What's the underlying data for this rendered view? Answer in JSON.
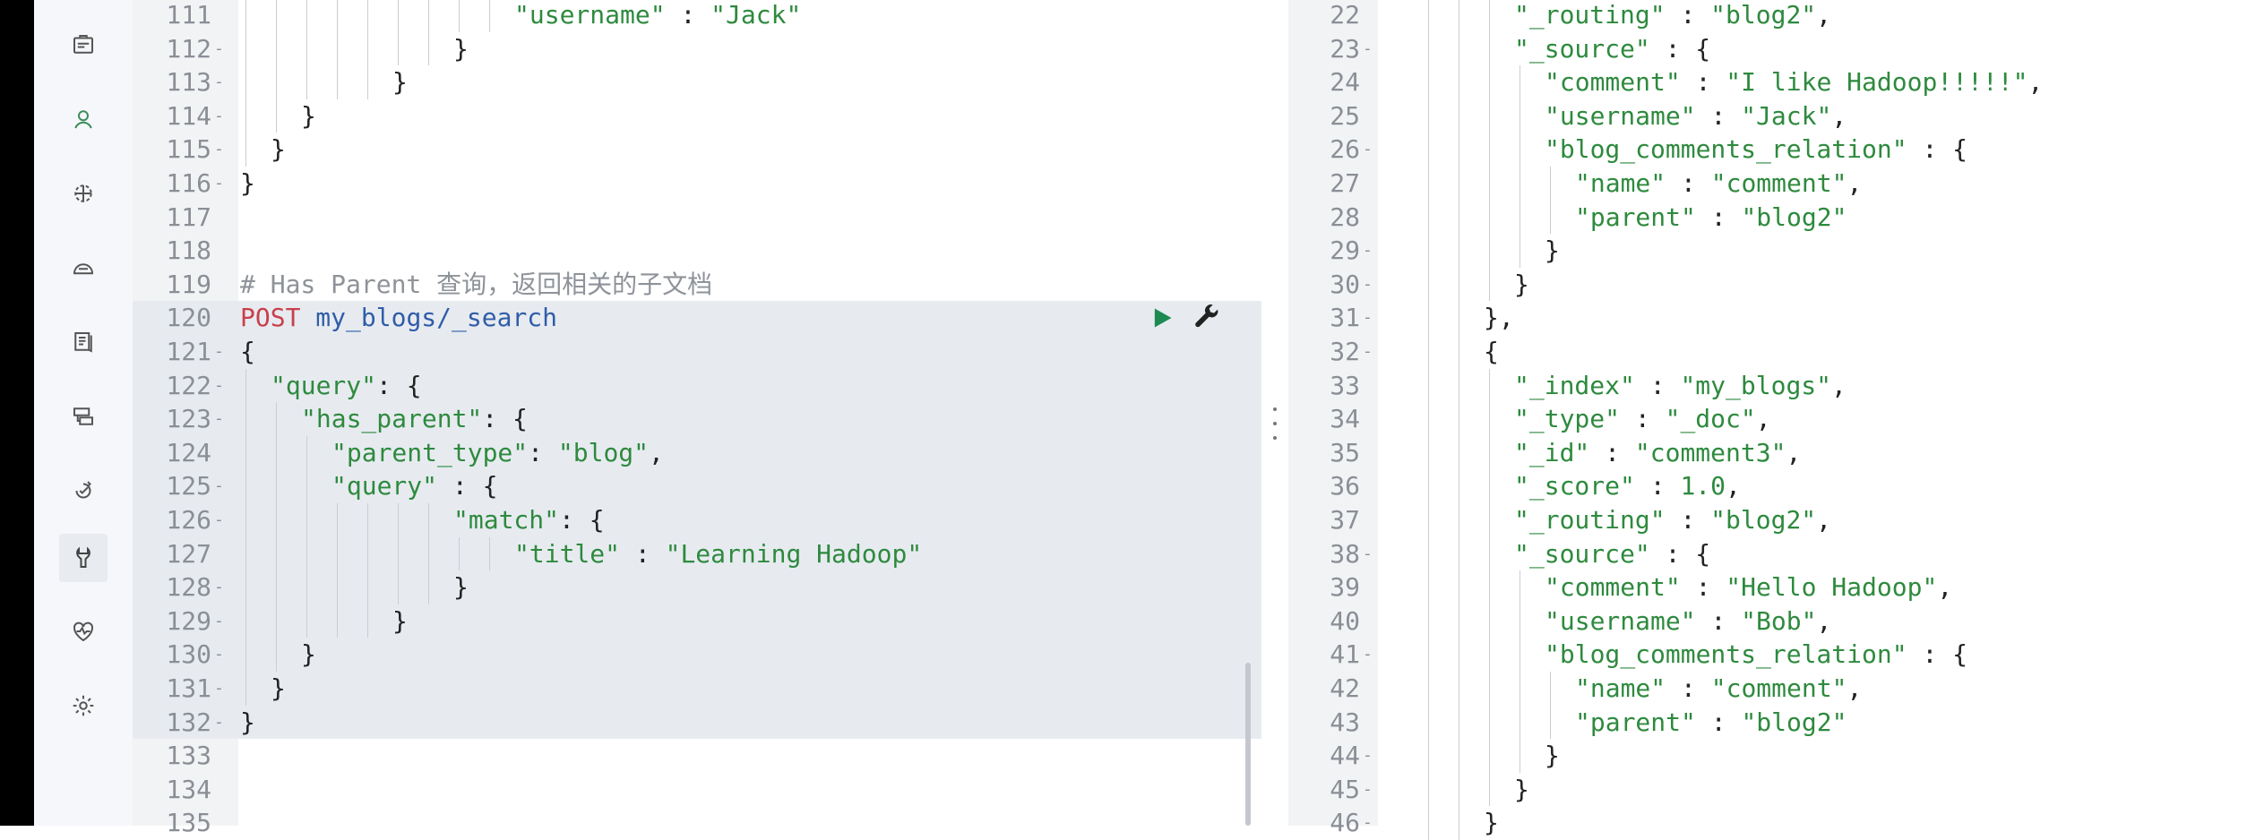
{
  "sidebar": {
    "items": [
      {
        "icon": "discover-icon"
      },
      {
        "icon": "maps-icon"
      },
      {
        "icon": "canvas-icon"
      },
      {
        "icon": "ml-icon"
      },
      {
        "icon": "infrastructure-icon"
      },
      {
        "icon": "logs-icon"
      },
      {
        "icon": "uptime-icon"
      },
      {
        "icon": "dev-tools-icon"
      },
      {
        "icon": "monitoring-icon"
      },
      {
        "icon": "management-icon"
      }
    ]
  },
  "editor": {
    "lines": [
      {
        "n": "111",
        "fold": "",
        "text": "\"username\" : \"Jack\"",
        "indent": 9
      },
      {
        "n": "112",
        "fold": "-",
        "text": "}",
        "indent": 7
      },
      {
        "n": "113",
        "fold": "-",
        "text": "}",
        "indent": 5
      },
      {
        "n": "114",
        "fold": "-",
        "text": "}",
        "indent": 2
      },
      {
        "n": "115",
        "fold": "-",
        "text": "}",
        "indent": 1
      },
      {
        "n": "116",
        "fold": "-",
        "text": "}",
        "indent": 0
      },
      {
        "n": "117",
        "fold": "",
        "text": "",
        "indent": 0
      },
      {
        "n": "118",
        "fold": "",
        "text": "",
        "indent": 0
      },
      {
        "n": "119",
        "fold": "",
        "text": "# Has Parent 查询，返回相关的子文档",
        "indent": 0
      },
      {
        "n": "120",
        "fold": "",
        "text": "POST my_blogs/_search",
        "indent": 0
      },
      {
        "n": "121",
        "fold": "-",
        "text": "{",
        "indent": 0
      },
      {
        "n": "122",
        "fold": "-",
        "text": "\"query\": {",
        "indent": 1
      },
      {
        "n": "123",
        "fold": "-",
        "text": "\"has_parent\": {",
        "indent": 2
      },
      {
        "n": "124",
        "fold": "",
        "text": "\"parent_type\": \"blog\",",
        "indent": 3
      },
      {
        "n": "125",
        "fold": "-",
        "text": "\"query\" : {",
        "indent": 3
      },
      {
        "n": "126",
        "fold": "-",
        "text": "\"match\": {",
        "indent": 7
      },
      {
        "n": "127",
        "fold": "",
        "text": "\"title\" : \"Learning Hadoop\"",
        "indent": 9
      },
      {
        "n": "128",
        "fold": "-",
        "text": "}",
        "indent": 7
      },
      {
        "n": "129",
        "fold": "-",
        "text": "}",
        "indent": 5
      },
      {
        "n": "130",
        "fold": "-",
        "text": "}",
        "indent": 2
      },
      {
        "n": "131",
        "fold": "-",
        "text": "}",
        "indent": 1
      },
      {
        "n": "132",
        "fold": "-",
        "text": "}",
        "indent": 0
      },
      {
        "n": "133",
        "fold": "",
        "text": "",
        "indent": 0
      },
      {
        "n": "134",
        "fold": "",
        "text": "",
        "indent": 0
      },
      {
        "n": "135",
        "fold": "",
        "text": "",
        "indent": 0
      }
    ]
  },
  "output": {
    "lines": [
      {
        "n": "22",
        "fold": "",
        "text": "\"_routing\" : \"blog2\",",
        "indent": 3
      },
      {
        "n": "23",
        "fold": "-",
        "text": "\"_source\" : {",
        "indent": 3
      },
      {
        "n": "24",
        "fold": "",
        "text": "\"comment\" : \"I like Hadoop!!!!!\",",
        "indent": 4
      },
      {
        "n": "25",
        "fold": "",
        "text": "\"username\" : \"Jack\",",
        "indent": 4
      },
      {
        "n": "26",
        "fold": "-",
        "text": "\"blog_comments_relation\" : {",
        "indent": 4
      },
      {
        "n": "27",
        "fold": "",
        "text": "\"name\" : \"comment\",",
        "indent": 5
      },
      {
        "n": "28",
        "fold": "",
        "text": "\"parent\" : \"blog2\"",
        "indent": 5
      },
      {
        "n": "29",
        "fold": "-",
        "text": "}",
        "indent": 4
      },
      {
        "n": "30",
        "fold": "-",
        "text": "}",
        "indent": 3
      },
      {
        "n": "31",
        "fold": "-",
        "text": "},",
        "indent": 2
      },
      {
        "n": "32",
        "fold": "-",
        "text": "{",
        "indent": 2
      },
      {
        "n": "33",
        "fold": "",
        "text": "\"_index\" : \"my_blogs\",",
        "indent": 3
      },
      {
        "n": "34",
        "fold": "",
        "text": "\"_type\" : \"_doc\",",
        "indent": 3
      },
      {
        "n": "35",
        "fold": "",
        "text": "\"_id\" : \"comment3\",",
        "indent": 3
      },
      {
        "n": "36",
        "fold": "",
        "text": "\"_score\" : 1.0,",
        "indent": 3
      },
      {
        "n": "37",
        "fold": "",
        "text": "\"_routing\" : \"blog2\",",
        "indent": 3
      },
      {
        "n": "38",
        "fold": "-",
        "text": "\"_source\" : {",
        "indent": 3
      },
      {
        "n": "39",
        "fold": "",
        "text": "\"comment\" : \"Hello Hadoop\",",
        "indent": 4
      },
      {
        "n": "40",
        "fold": "",
        "text": "\"username\" : \"Bob\",",
        "indent": 4
      },
      {
        "n": "41",
        "fold": "-",
        "text": "\"blog_comments_relation\" : {",
        "indent": 4
      },
      {
        "n": "42",
        "fold": "",
        "text": "\"name\" : \"comment\",",
        "indent": 5
      },
      {
        "n": "43",
        "fold": "",
        "text": "\"parent\" : \"blog2\"",
        "indent": 5
      },
      {
        "n": "44",
        "fold": "-",
        "text": "}",
        "indent": 4
      },
      {
        "n": "45",
        "fold": "-",
        "text": "}",
        "indent": 3
      },
      {
        "n": "46",
        "fold": "-",
        "text": "}",
        "indent": 2
      }
    ]
  },
  "colors": {
    "key": "#2e8a3e",
    "comment": "#8e9399",
    "method": "#c93f4a",
    "url": "#305da8",
    "run": "#1d8a52"
  }
}
